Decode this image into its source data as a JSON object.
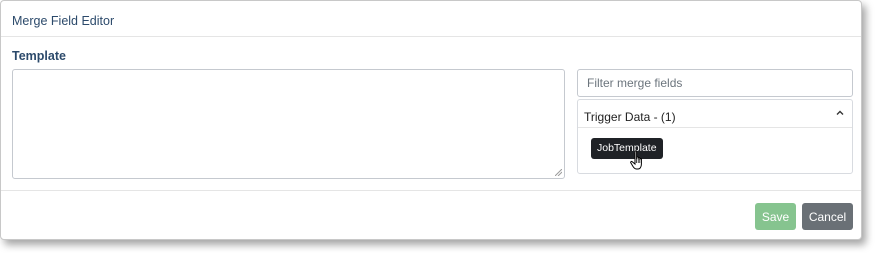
{
  "dialog": {
    "title": "Merge Field Editor"
  },
  "template": {
    "label": "Template",
    "value": ""
  },
  "filter": {
    "placeholder": "Filter merge fields",
    "value": ""
  },
  "trigger_group": {
    "title": "Trigger Data - (1)",
    "expanded": true,
    "fields": [
      {
        "label": "JobTemplate"
      }
    ]
  },
  "footer": {
    "save_label": "Save",
    "cancel_label": "Cancel",
    "save_disabled": true
  },
  "colors": {
    "title_text": "#2c4a6b",
    "save_button": "#86c48f",
    "cancel_button": "#6a7076",
    "chip_background": "#1f2226"
  },
  "icons": {
    "accordion_toggle": "chevron-up-icon",
    "cursor": "hand-pointer-icon",
    "resize": "resize-grip-icon"
  }
}
